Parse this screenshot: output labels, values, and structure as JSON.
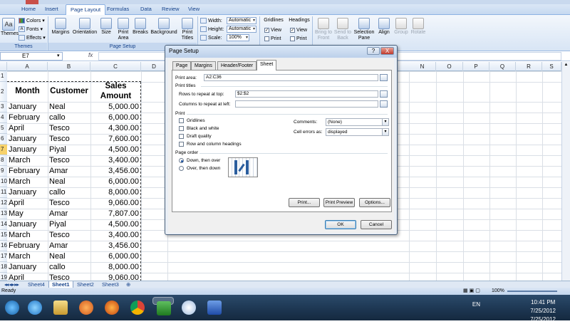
{
  "ribbon": {
    "tabs": [
      "Home",
      "Insert",
      "Page Layout",
      "Formulas",
      "Data",
      "Review",
      "View"
    ],
    "active_tab": "Page Layout",
    "themes": {
      "themes": "Themes",
      "colors": "Colors",
      "fonts": "Fonts",
      "effects": "Effects",
      "group": "Themes"
    },
    "page_setup": {
      "margins": "Margins",
      "orientation": "Orientation",
      "size": "Size",
      "print_area": "Print Area",
      "breaks": "Breaks",
      "background": "Background",
      "print_titles": "Print Titles",
      "group": "Page Setup"
    },
    "scale": {
      "width_label": "Width:",
      "width_value": "Automatic",
      "height_label": "Height:",
      "height_value": "Automatic",
      "scale_label": "Scale:",
      "scale_value": "100%"
    },
    "sheet_options": {
      "gridlines": "Gridlines",
      "headings": "Headings",
      "view": "View",
      "print": "Print"
    },
    "arrange": {
      "bring_to_front": "Bring to Front",
      "send_to_back": "Send to Back",
      "selection_pane": "Selection Pane",
      "align": "Align",
      "group": "Group",
      "rotate": "Rotate"
    }
  },
  "formula_bar": {
    "name_box": "E7",
    "fx": "fx",
    "content": ""
  },
  "columns": [
    "A",
    "B",
    "C",
    "D",
    "E",
    "F",
    "G",
    "H",
    "I",
    "J",
    "K",
    "L",
    "M",
    "N",
    "O",
    "P",
    "Q",
    "R",
    "S"
  ],
  "rows": [
    "1",
    "2",
    "3",
    "4",
    "5",
    "6",
    "7",
    "8",
    "9",
    "10",
    "11",
    "12",
    "13",
    "14",
    "15",
    "16",
    "17",
    "18",
    "19"
  ],
  "table": {
    "headers": {
      "month": "Month",
      "customer": "Customer",
      "sales_line1": "Sales",
      "sales_line2": "Amount"
    },
    "data": [
      [
        "January",
        "Neal",
        "5,000.00"
      ],
      [
        "February",
        "callo",
        "6,000.00"
      ],
      [
        "April",
        "Tesco",
        "4,300.00"
      ],
      [
        "January",
        "Tesco",
        "7,600.00"
      ],
      [
        "January",
        "Piyal",
        "4,500.00"
      ],
      [
        "March",
        "Tesco",
        "3,400.00"
      ],
      [
        "February",
        "Amar",
        "3,456.00"
      ],
      [
        "March",
        "Neal",
        "6,000.00"
      ],
      [
        "January",
        "callo",
        "8,000.00"
      ],
      [
        "April",
        "Tesco",
        "9,060.00"
      ],
      [
        "May",
        "Amar",
        "7,807.00"
      ],
      [
        "January",
        "Piyal",
        "4,500.00"
      ],
      [
        "March",
        "Tesco",
        "3,400.00"
      ],
      [
        "February",
        "Amar",
        "3,456.00"
      ],
      [
        "March",
        "Neal",
        "6,000.00"
      ],
      [
        "January",
        "callo",
        "8,000.00"
      ],
      [
        "April",
        "Tesco",
        "9,060.00"
      ]
    ]
  },
  "sheet_tabs": [
    "Sheet4",
    "Sheet1",
    "Sheet2",
    "Sheet3"
  ],
  "active_sheet": "Sheet1",
  "status": {
    "ready": "Ready",
    "zoom": "100%"
  },
  "dialog": {
    "title": "Page Setup",
    "help": "?",
    "close": "X",
    "tabs": [
      "Page",
      "Margins",
      "Header/Footer",
      "Sheet"
    ],
    "active_tab": "Sheet",
    "print_area_label": "Print area:",
    "print_area_value": "A2:C36",
    "print_titles_label": "Print titles",
    "rows_repeat_label": "Rows to repeat at top:",
    "rows_repeat_value": "$2:$2",
    "cols_repeat_label": "Columns to repeat at left:",
    "cols_repeat_value": "",
    "print_label": "Print",
    "checks": [
      "Gridlines",
      "Black and white",
      "Draft quality",
      "Row and column headings"
    ],
    "comments_label": "Comments:",
    "comments_value": "(None)",
    "cell_errors_label": "Cell errors as:",
    "cell_errors_value": "displayed",
    "page_order_label": "Page order",
    "order_down": "Down, then over",
    "order_over": "Over, then down",
    "btn_print": "Print...",
    "btn_preview": "Print Preview",
    "btn_options": "Options...",
    "btn_ok": "OK",
    "btn_cancel": "Cancel"
  },
  "taskbar": {
    "lang": "EN",
    "time": "10:41 PM",
    "date1": "7/25/2012",
    "date2": "7/25/2012",
    "apps": [
      "start-orb-icon",
      "ie-icon",
      "explorer-icon",
      "media-player-icon",
      "firefox-icon",
      "chrome-icon",
      "excel-icon",
      "paint-icon",
      "word-icon"
    ]
  }
}
